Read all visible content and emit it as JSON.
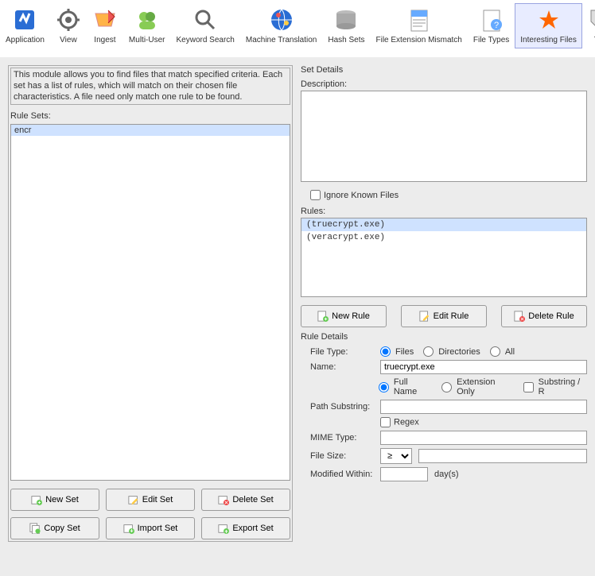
{
  "toolbar": [
    {
      "label": "Application",
      "icon": "app"
    },
    {
      "label": "View",
      "icon": "view"
    },
    {
      "label": "Ingest",
      "icon": "ingest"
    },
    {
      "label": "Multi-User",
      "icon": "multi"
    },
    {
      "label": "Keyword Search",
      "icon": "search"
    },
    {
      "label": "Machine Translation",
      "icon": "translate"
    },
    {
      "label": "Hash Sets",
      "icon": "hash"
    },
    {
      "label": "File Extension Mismatch",
      "icon": "mismatch"
    },
    {
      "label": "File Types",
      "icon": "types"
    },
    {
      "label": "Interesting Files",
      "icon": "star",
      "active": true
    },
    {
      "label": "Tag",
      "icon": "tag"
    }
  ],
  "module_desc": "This module allows you to find files that match specified criteria. Each set has a list of rules, which will match on their chosen file characteristics. A file need only match one rule to be found.",
  "labels": {
    "rule_sets": "Rule Sets:",
    "set_details": "Set Details",
    "description": "Description:",
    "ignore_known": "Ignore Known Files",
    "rules": "Rules:",
    "rule_details": "Rule Details",
    "file_type": "File Type:",
    "name": "Name:",
    "path_substring": "Path Substring:",
    "mime_type": "MIME Type:",
    "file_size": "File Size:",
    "modified_within": "Modified Within:",
    "days": "day(s)",
    "regex": "Regex",
    "files": "Files",
    "directories": "Directories",
    "all": "All",
    "full_name": "Full Name",
    "ext_only": "Extension Only",
    "substring": "Substring / R"
  },
  "rule_sets": [
    {
      "name": "encr",
      "selected": true
    }
  ],
  "set_btns": {
    "new": "New Set",
    "edit": "Edit Set",
    "delete": "Delete Set",
    "copy": "Copy Set",
    "import": "Import Set",
    "export": "Export Set"
  },
  "rule_btns": {
    "new": "New Rule",
    "edit": "Edit Rule",
    "delete": "Delete Rule"
  },
  "rules": [
    {
      "name": "(truecrypt.exe)",
      "selected": true
    },
    {
      "name": "(veracrypt.exe)"
    }
  ],
  "detail": {
    "file_type": "files",
    "name": "truecrypt.exe",
    "name_mode": "full",
    "size_op": "≥"
  }
}
